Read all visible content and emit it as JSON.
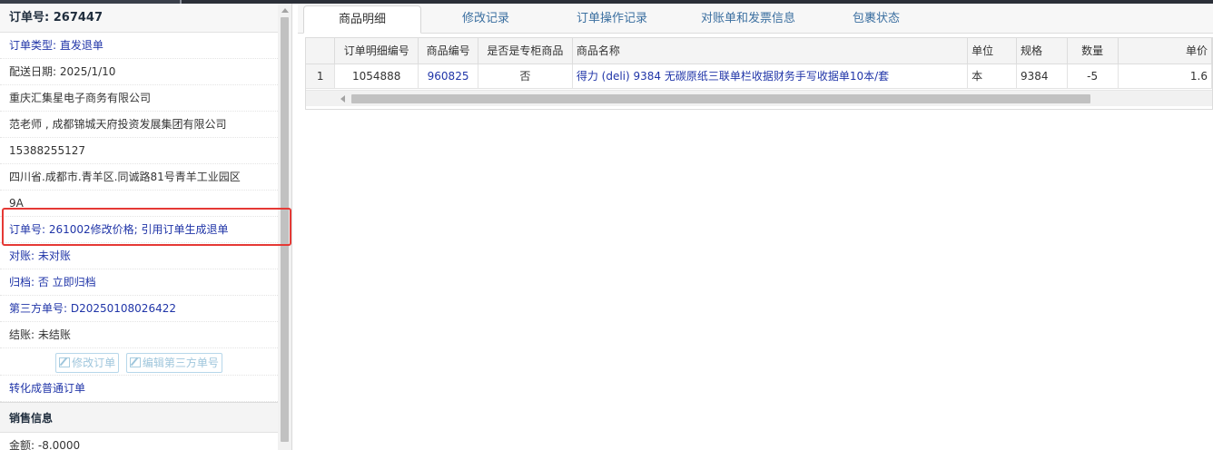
{
  "left": {
    "order_no_label": "订单号: 267447",
    "order_type": "订单类型: 直发退单",
    "delivery_date": "配送日期: 2025/1/10",
    "supplier": "重庆汇集星电子商务有限公司",
    "customer": "范老师 , 成都锦城天府投资发展集团有限公司",
    "phone": "15388255127",
    "address_line1": "四川省.成都市.青羊区.同诚路81号青羊工业园区",
    "address_line2": "9A",
    "note": "订单号: 261002修改价格; 引用订单生成退单",
    "reconcile": "对账: 未对账",
    "archive": "归档:  否 立即归档",
    "third_party_no": "第三方单号: D20250108026422",
    "settlement": "结账: 未结账",
    "edit_order_btn": "修改订单",
    "edit_third_btn": "编辑第三方单号",
    "convert_link": "转化成普通订单",
    "sales_section": "销售信息",
    "amount": "金额: -8.0000"
  },
  "tabs": [
    {
      "label": "商品明细",
      "active": true
    },
    {
      "label": "修改记录",
      "active": false
    },
    {
      "label": "订单操作记录",
      "active": false
    },
    {
      "label": "对账单和发票信息",
      "active": false
    },
    {
      "label": "包裹状态",
      "active": false
    }
  ],
  "grid": {
    "columns": [
      "",
      "订单明细编号",
      "商品编号",
      "是否是专柜商品",
      "商品名称",
      "单位",
      "规格",
      "数量",
      "单价"
    ],
    "rows": [
      [
        "1",
        "1054888",
        "960825",
        "否",
        "得力 (deli)  9384 无碳原纸三联单栏收据财务手写收据单10本/套",
        "本",
        "9384",
        "-5",
        "1.6"
      ]
    ]
  },
  "colors": {
    "link_blue": "#2035a8",
    "tab_blue": "#3b6fa0",
    "highlight_red": "#e53935"
  }
}
